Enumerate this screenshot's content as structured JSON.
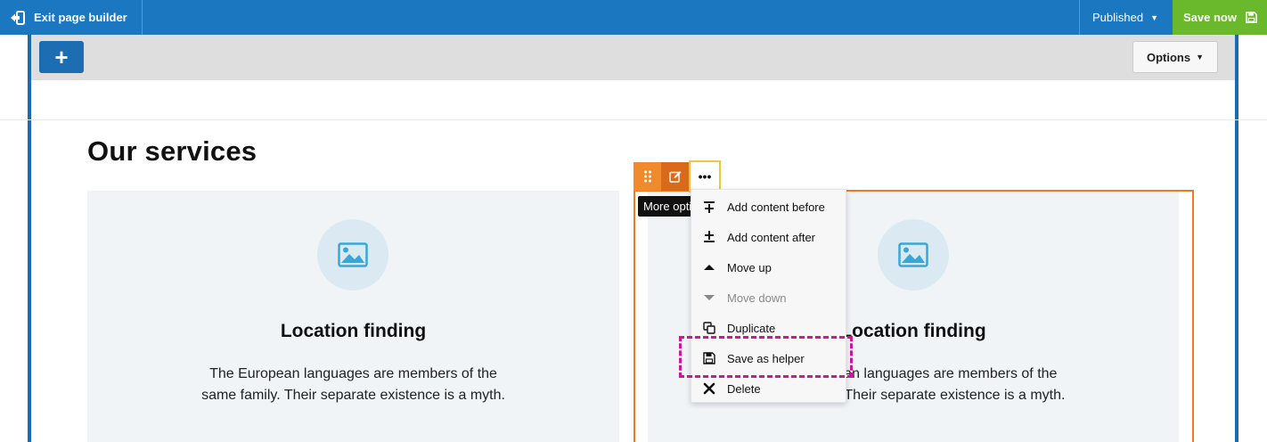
{
  "topbar": {
    "exit_label": "Exit page builder",
    "status_label": "Published",
    "save_label": "Save now"
  },
  "toolbar": {
    "add_label": "+",
    "options_label": "Options"
  },
  "section": {
    "title": "Our services"
  },
  "cards": [
    {
      "heading": "Location finding",
      "body": "The European languages are members of the same family. Their separate existence is a myth."
    },
    {
      "heading": "Location finding",
      "body": "The European languages are members of the same family. Their separate existence is a myth."
    }
  ],
  "element_toolbar": {
    "more_label": "•••",
    "tooltip": "More options"
  },
  "menu": {
    "items": [
      {
        "label": "Add content before",
        "icon": "insert-before-icon",
        "disabled": false
      },
      {
        "label": "Add content after",
        "icon": "insert-after-icon",
        "disabled": false
      },
      {
        "label": "Move up",
        "icon": "triangle-up-icon",
        "disabled": false
      },
      {
        "label": "Move down",
        "icon": "triangle-down-icon",
        "disabled": true
      },
      {
        "label": "Duplicate",
        "icon": "duplicate-icon",
        "disabled": false
      },
      {
        "label": "Save as helper",
        "icon": "floppy-disk-icon",
        "disabled": false
      },
      {
        "label": "Delete",
        "icon": "close-icon",
        "disabled": false
      }
    ]
  },
  "colors": {
    "topbar": "#1b77bf",
    "save": "#6ab82b",
    "selection": "#ef7a22",
    "highlight": "#d3149a"
  }
}
